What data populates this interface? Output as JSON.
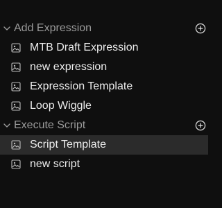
{
  "sections": [
    {
      "title": "Add Expression",
      "items": [
        {
          "label": "MTB Draft Expression",
          "icon": "image-icon",
          "selected": false
        },
        {
          "label": "new expression",
          "icon": "image-icon",
          "selected": false
        },
        {
          "label": "Expression Template",
          "icon": "image-icon",
          "selected": false
        },
        {
          "label": "Loop Wiggle",
          "icon": "image-icon",
          "selected": false
        }
      ]
    },
    {
      "title": "Execute Script",
      "items": [
        {
          "label": "Script Template",
          "icon": "image-icon",
          "selected": true
        },
        {
          "label": "new script",
          "icon": "image-icon",
          "selected": false
        }
      ]
    }
  ],
  "colors": {
    "background": "#0f0f0f",
    "header_text": "#9a9a9a",
    "item_text": "#ececec",
    "selected_row": "#2b2b2b"
  }
}
